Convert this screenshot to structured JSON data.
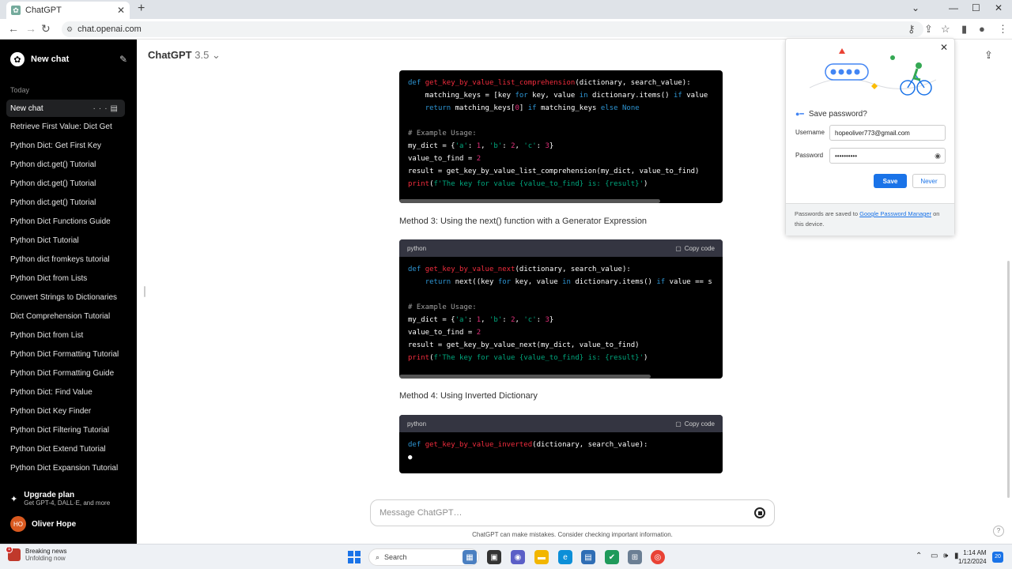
{
  "browser": {
    "tab_title": "ChatGPT",
    "url": "chat.openai.com"
  },
  "sidebar": {
    "new_chat": "New chat",
    "section_today": "Today",
    "active_item": "New chat",
    "items": [
      "Retrieve First Value: Dict Get",
      "Python Dict: Get First Key",
      "Python dict.get() Tutorial",
      "Python dict.get() Tutorial",
      "Python dict.get() Tutorial",
      "Python Dict Functions Guide",
      "Python Dict Tutorial",
      "Python dict fromkeys tutorial",
      "Python Dict from Lists",
      "Convert Strings to Dictionaries",
      "Dict Comprehension Tutorial",
      "Python Dict from List",
      "Python Dict Formatting Tutorial",
      "Python Dict Formatting Guide",
      "Python Dict: Find Value",
      "Python Dict Key Finder",
      "Python Dict Filtering Tutorial",
      "Python Dict Extend Tutorial",
      "Python Dict Expansion Tutorial"
    ],
    "upgrade_title": "Upgrade plan",
    "upgrade_sub": "Get GPT-4, DALL·E, and more",
    "user_initials": "HO",
    "user_name": "Oliver Hope"
  },
  "main": {
    "model_name": "ChatGPT",
    "model_version": "3.5",
    "method3": "Method 3: Using the next() function with a Generator Expression",
    "method4": "Method 4: Using Inverted Dictionary",
    "code_lang": "python",
    "copy_label": "Copy code",
    "message_placeholder": "Message ChatGPT…",
    "disclaimer": "ChatGPT can make mistakes. Consider checking important information.",
    "help": "?"
  },
  "password_popup": {
    "title": "Save password?",
    "username_label": "Username",
    "username_value": "hopeoliver773@gmail.com",
    "password_label": "Password",
    "password_value": "••••••••••",
    "save_label": "Save",
    "never_label": "Never",
    "footer_text_1": "Passwords are saved to ",
    "footer_link": "Google Password Manager",
    "footer_text_2": " on this device."
  },
  "taskbar": {
    "news_title": "Breaking news",
    "news_sub": "Unfolding now",
    "news_badge": "1",
    "search_label": "Search",
    "time": "1:14 AM",
    "date": "1/12/2024",
    "notification_count": "20"
  },
  "colors": {
    "sidebar_bg": "#000000",
    "code_bg": "#000000",
    "accent_blue": "#1a73e8"
  }
}
